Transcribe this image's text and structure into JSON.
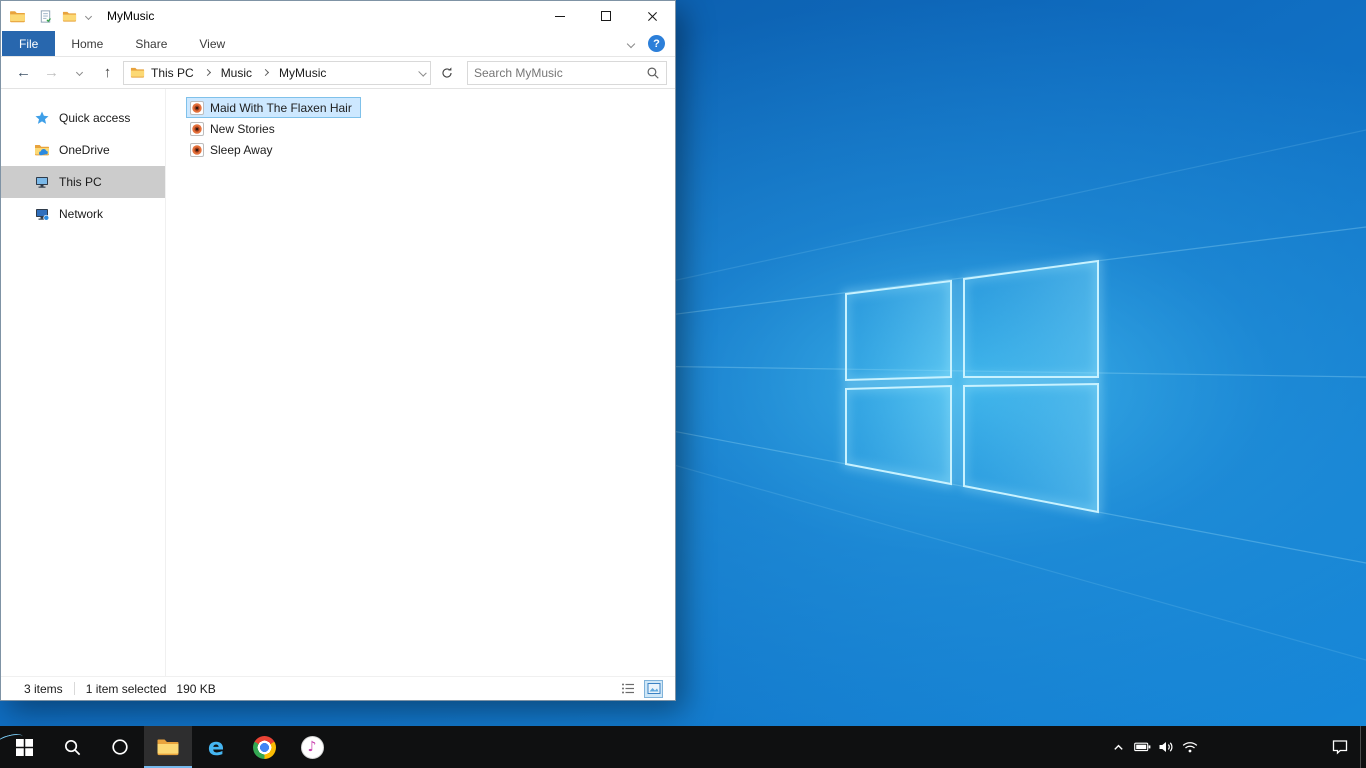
{
  "window": {
    "title": "MyMusic",
    "help_label": "?",
    "tabs": [
      {
        "label": "File",
        "active": true
      },
      {
        "label": "Home",
        "active": false
      },
      {
        "label": "Share",
        "active": false
      },
      {
        "label": "View",
        "active": false
      }
    ],
    "address": {
      "breadcrumbs": [
        {
          "label": "This PC"
        },
        {
          "label": "Music"
        },
        {
          "label": "MyMusic"
        }
      ]
    },
    "search": {
      "placeholder": "Search MyMusic",
      "value": ""
    },
    "sidebar": {
      "items": [
        {
          "label": "Quick access",
          "icon": "star-icon",
          "selected": false
        },
        {
          "label": "OneDrive",
          "icon": "onedrive-folder-icon",
          "selected": false
        },
        {
          "label": "This PC",
          "icon": "computer-icon",
          "selected": true
        },
        {
          "label": "Network",
          "icon": "network-icon",
          "selected": false
        }
      ]
    },
    "files": [
      {
        "name": "Maid With The Flaxen Hair",
        "icon": "music-file-icon",
        "selected": true
      },
      {
        "name": "New Stories",
        "icon": "music-file-icon",
        "selected": false
      },
      {
        "name": "Sleep Away",
        "icon": "music-file-icon",
        "selected": false
      }
    ],
    "statusbar": {
      "count": "3 items",
      "selected": "1 item selected",
      "size": "190 KB"
    }
  },
  "icons": {
    "back": "←",
    "forward": "→",
    "up": "↑",
    "music_note": "♪",
    "ie_letter": "e"
  },
  "taskbar": {
    "buttons": [
      "start",
      "search",
      "cortana",
      "file-explorer (active)",
      "internet-explorer",
      "chrome",
      "itunes"
    ],
    "tray": [
      "hidden-icons-chevron",
      "battery",
      "volume",
      "wifi",
      "action-center",
      "show-desktop"
    ]
  },
  "colors": {
    "file_tab_blue": "#2867ae",
    "selection_bg": "#cde8ff",
    "selection_border": "#7fc1ea",
    "sidebar_selected": "#cccccc",
    "taskbar_bg": "#0f1011",
    "taskbar_active_underline": "#76b9ed",
    "wallpaper_base": "#0d64b4",
    "logo_glow": "#47c0f0"
  }
}
